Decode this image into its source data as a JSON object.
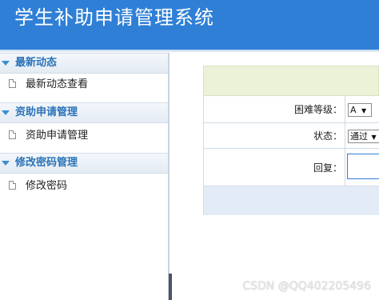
{
  "app": {
    "title": "学生补助申请管理系统"
  },
  "sidebar": {
    "groups": [
      {
        "label": "最新动态",
        "items": [
          {
            "label": "最新动态查看"
          }
        ]
      },
      {
        "label": "资助申请管理",
        "items": [
          {
            "label": "资助申请管理"
          }
        ]
      },
      {
        "label": "修改密码管理",
        "items": [
          {
            "label": "修改密码"
          }
        ]
      }
    ]
  },
  "form": {
    "difficulty": {
      "label": "困难等级：",
      "value": "A"
    },
    "status": {
      "label": "状态：",
      "value": "通过"
    },
    "reply": {
      "label": "回复：",
      "value": ""
    }
  },
  "watermark": "CSDN @QQ402205496",
  "colors": {
    "header": "#2f7fd6",
    "group_text": "#2a73b8",
    "form_bar": "#ebf2d8"
  }
}
